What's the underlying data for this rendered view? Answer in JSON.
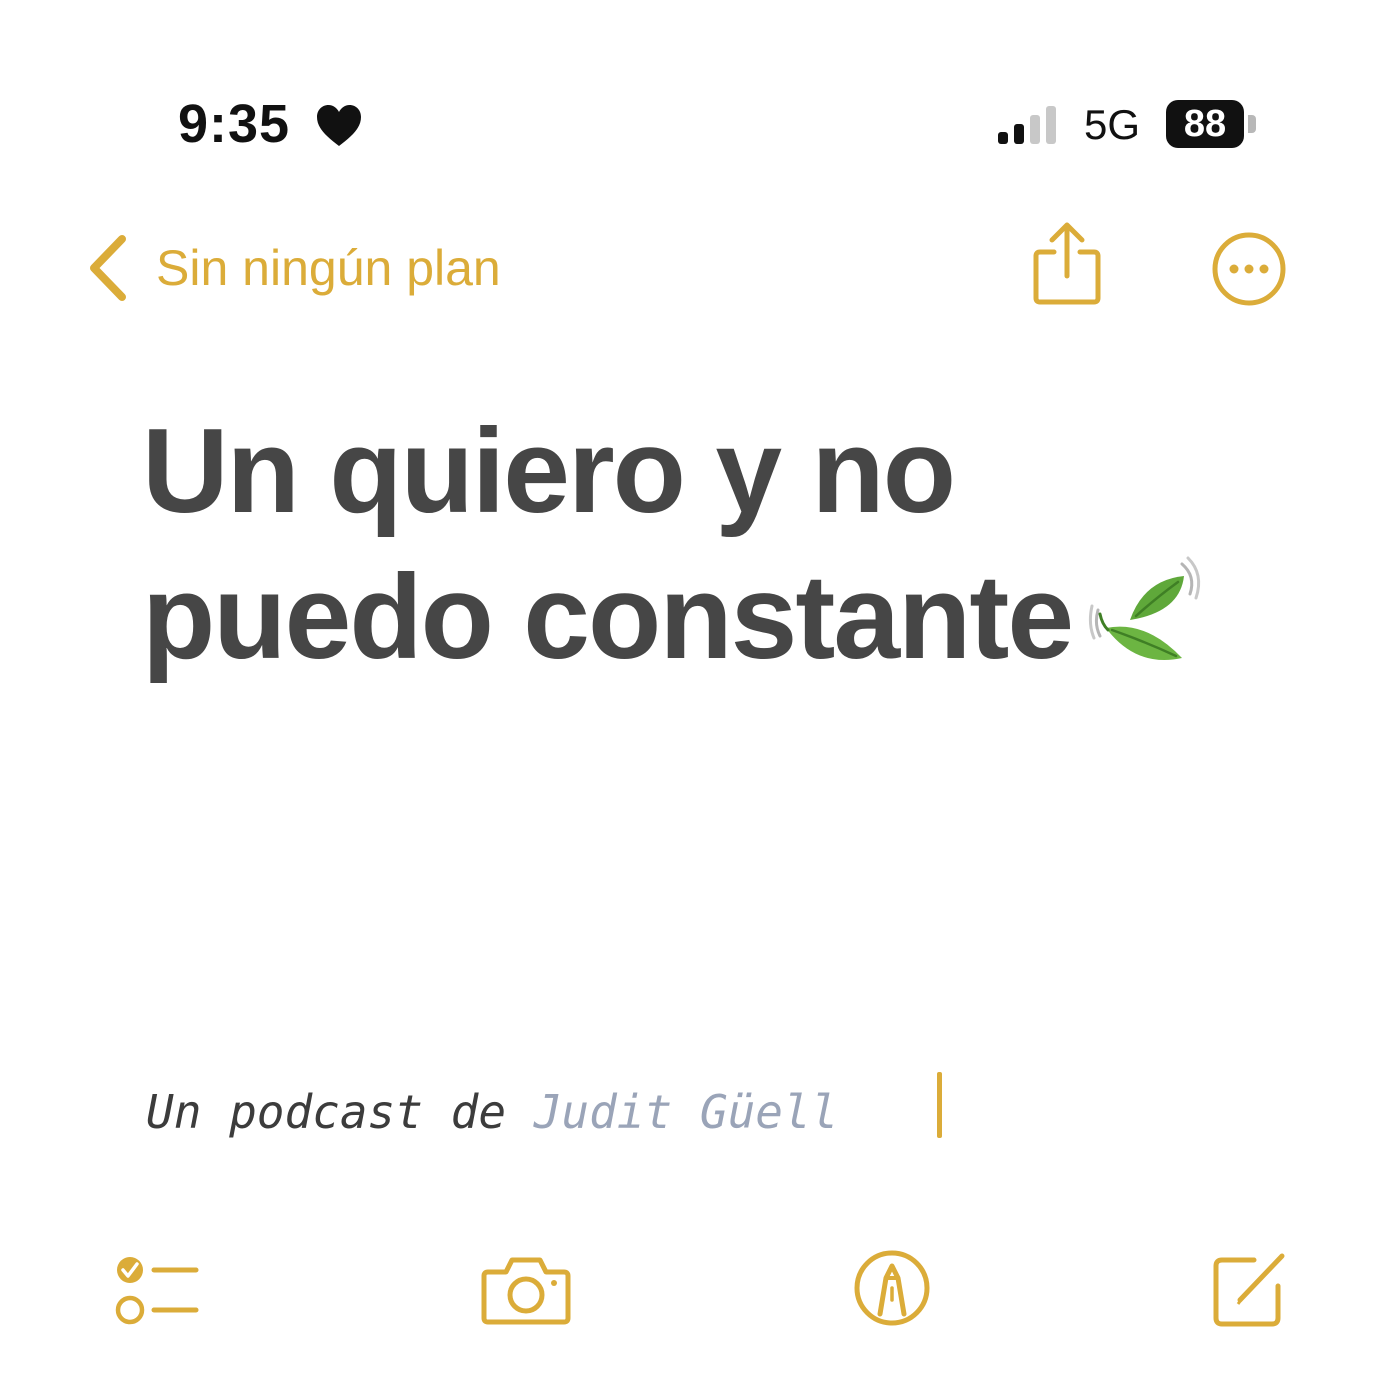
{
  "status_bar": {
    "time": "9:35",
    "focus_icon": "heart-icon",
    "signal_icon": "cellular-signal-icon",
    "network": "5G",
    "battery": "88"
  },
  "nav": {
    "back_label": "Sin ningún plan",
    "back_icon": "chevron-left-icon",
    "share_icon": "share-icon",
    "more_icon": "more-icon"
  },
  "note": {
    "title": "Un quiero y no puedo constante",
    "title_emoji_icon": "leaf-fluttering-in-wind-icon",
    "subtitle_prefix": "Un podcast de ",
    "subtitle_author": "Judit Güell"
  },
  "toolbar": {
    "checklist_icon": "checklist-icon",
    "camera_icon": "camera-icon",
    "markup_icon": "markup-pen-icon",
    "compose_icon": "compose-icon"
  },
  "colors": {
    "accent": "#dbac39",
    "title_text": "#464646",
    "author_text": "#9aa4b8",
    "background": "#ffffff"
  }
}
